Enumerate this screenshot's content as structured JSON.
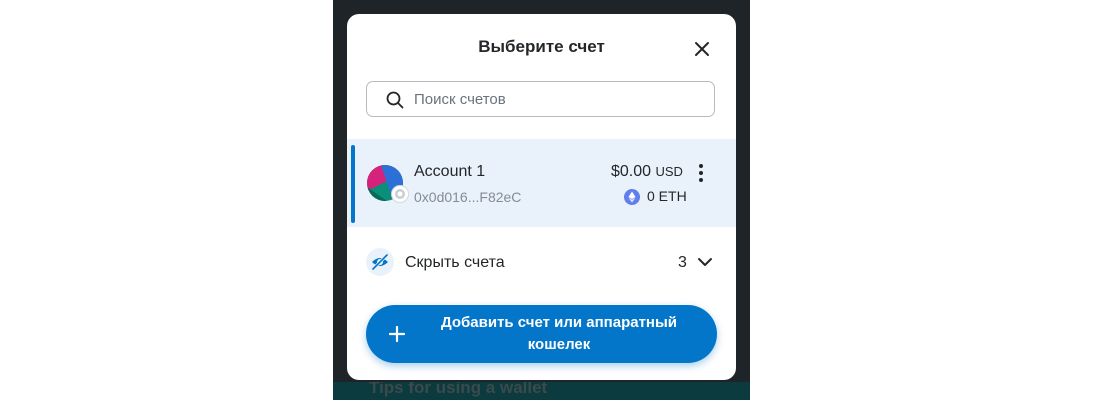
{
  "background_hint": {
    "text": "Tips for using a wallet"
  },
  "modal": {
    "title": "Выберите счет",
    "close_icon": "close-icon"
  },
  "search": {
    "placeholder": "Поиск счетов",
    "value": ""
  },
  "accounts": [
    {
      "name": "Account 1",
      "address": "0x0d016...F82eC",
      "fiat_amount": "$0.00",
      "fiat_currency": "USD",
      "token_balance": "0 ETH",
      "selected": true
    }
  ],
  "hidden_accounts": {
    "label": "Скрыть счета",
    "count": "3"
  },
  "add_button": {
    "label": "Добавить счет или аппаратный кошелек"
  },
  "colors": {
    "accent": "#0376c9",
    "selected_bg": "#e9f2fb",
    "text": "#24272a",
    "muted": "#858b93",
    "eth": "#627eea"
  }
}
